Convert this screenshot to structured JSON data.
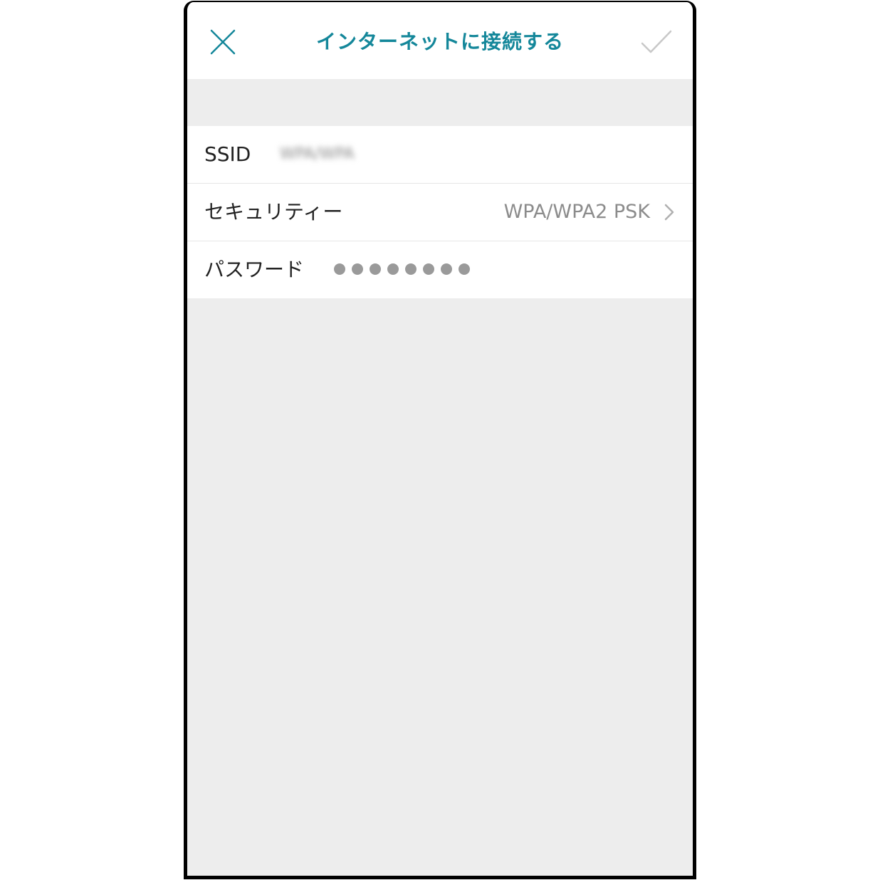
{
  "nav": {
    "title": "インターネットに接続する",
    "close_icon": "close-icon",
    "done_icon": "checkmark-icon",
    "accent_color": "#14879a"
  },
  "form": {
    "ssid": {
      "label": "SSID",
      "value": "WPA/WPA"
    },
    "security": {
      "label": "セキュリティー",
      "value": "WPA/WPA2 PSK",
      "icon": "chevron-right-icon"
    },
    "password": {
      "label": "パスワード",
      "masked_length": 8
    }
  }
}
